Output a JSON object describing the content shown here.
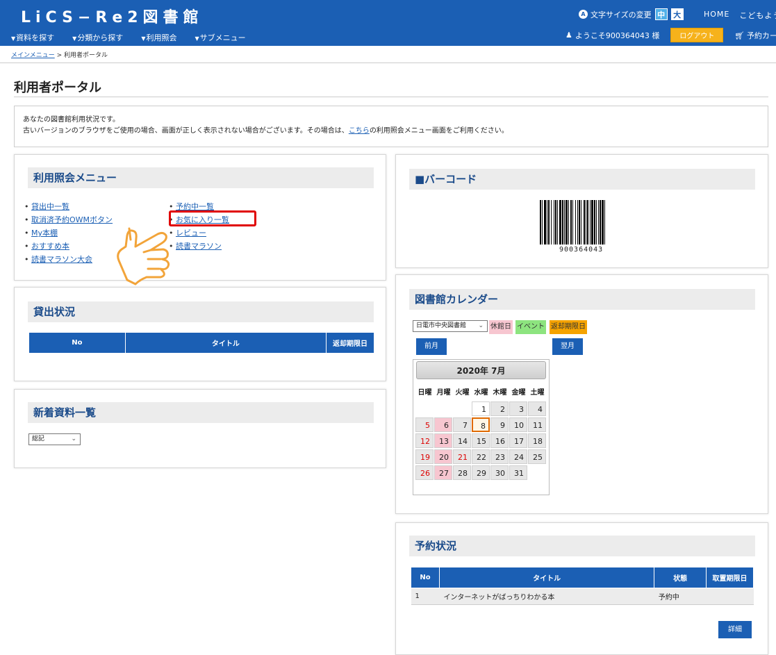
{
  "header": {
    "site_title": "LiCS−Re2図書館",
    "nav": [
      {
        "label": "資料を探す"
      },
      {
        "label": "分類から探す"
      },
      {
        "label": "利用照会"
      },
      {
        "label": "サブメニュー"
      }
    ],
    "font_size_label": "文字サイズの変更",
    "font_size_medium": "中",
    "font_size_large": "大",
    "home_link": "HOME",
    "kids_link": "こどもよう",
    "welcome_text": "ようこそ900364043 様",
    "logout_label": "ログアウト",
    "cart_label": "予約カート",
    "brand_color": "#1b5fb4"
  },
  "breadcrumb": {
    "home": "メインメニュー",
    "separator": ">",
    "current": "利用者ポータル"
  },
  "page_title": "利用者ポータル",
  "info": {
    "line1": "あなたの図書館利用状況です。",
    "line2_before": "古いバージョンのブラウザをご使用の場合、画面が正しく表示されない場合がございます。その場合は、",
    "line2_link": "こちら",
    "line2_after": "の利用照会メニュー画面をご利用ください。"
  },
  "menu_panel": {
    "title": "利用照会メニュー",
    "left_items": [
      "貸出中一覧",
      "取消済予約OWMボタン",
      "My本棚",
      "おすすめ本",
      "読書マラソン大会"
    ],
    "right_items": [
      "予約中一覧",
      "お気に入り一覧",
      "レビュー",
      "読書マラソン"
    ],
    "highlighted_item": "お気に入り一覧",
    "highlight_color": "#e00000",
    "pointer_icon": "hand-pointer-icon"
  },
  "loan_panel": {
    "title": "貸出状況",
    "columns": [
      "No",
      "タイトル",
      "返却期限日"
    ]
  },
  "new_panel": {
    "title": "新着資料一覧",
    "select_value": "総記"
  },
  "barcode_panel": {
    "title": "■バーコード",
    "number": "900364043"
  },
  "calendar_panel": {
    "title": "図書館カレンダー",
    "library_select": "日電市中央図書館",
    "legend_closed": "休館日",
    "legend_event": "イベント",
    "legend_due": "返却期限日",
    "prev_label": "前月",
    "next_label": "翌月",
    "month_title": "2020年 7月",
    "weekdays": [
      "日曜",
      "月曜",
      "火曜",
      "水曜",
      "木曜",
      "金曜",
      "土曜"
    ],
    "today": 8,
    "closed_days": [
      6,
      13,
      20,
      27
    ],
    "red_days": [
      5,
      12,
      19,
      26,
      21
    ],
    "colors": {
      "closed": "#f7c6d0",
      "event": "#8de47f",
      "due": "#f5a300"
    }
  },
  "reserve_panel": {
    "title": "予約状況",
    "columns": [
      "No",
      "タイトル",
      "状態",
      "取置期限日"
    ],
    "rows": [
      {
        "no": "1",
        "title": "インターネットがばっちりわかる本",
        "status": "予約中",
        "deadline": ""
      }
    ],
    "detail_label": "詳細"
  }
}
